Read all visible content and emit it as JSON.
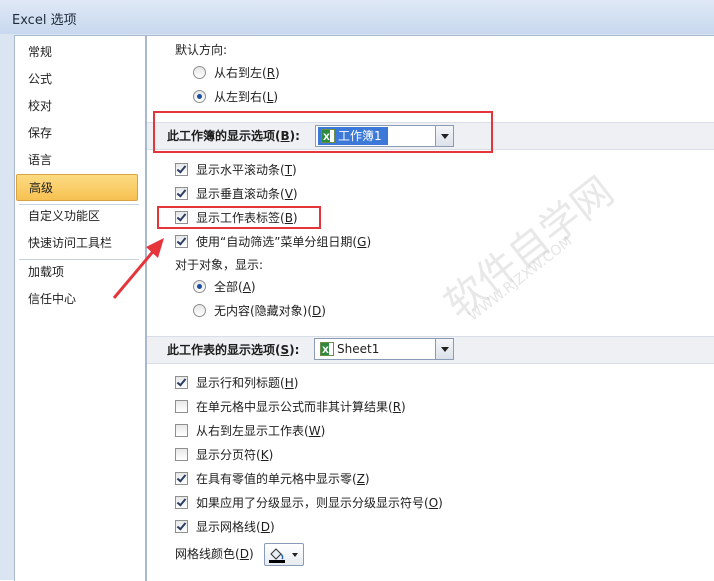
{
  "window": {
    "title": "Excel 选项"
  },
  "sidebar": {
    "items": [
      {
        "label": "常规"
      },
      {
        "label": "公式"
      },
      {
        "label": "校对"
      },
      {
        "label": "保存"
      },
      {
        "label": "语言"
      },
      {
        "label": "高级",
        "active": true
      },
      {
        "label": "自定义功能区"
      },
      {
        "label": "快速访问工具栏"
      },
      {
        "label": "加载项"
      },
      {
        "label": "信任中心"
      }
    ]
  },
  "direction": {
    "label": "默认方向:",
    "rtl": {
      "text": "从右到左(",
      "key": "R",
      "end": ")",
      "checked": false
    },
    "ltr": {
      "text": "从左到右(",
      "key": "L",
      "end": ")",
      "checked": true
    }
  },
  "workbook_section": {
    "label_pre": "此工作簿的显示选项(",
    "key": "B",
    "label_post": "):",
    "selected": "工作簿1"
  },
  "workbook_options": [
    {
      "text": "显示水平滚动条(",
      "key": "T",
      "end": ")",
      "checked": true
    },
    {
      "text": "显示垂直滚动条(",
      "key": "V",
      "end": ")",
      "checked": true
    },
    {
      "text": "显示工作表标签(",
      "key": "B",
      "end": ")",
      "checked": true
    },
    {
      "text": "使用“自动筛选”菜单分组日期(",
      "key": "G",
      "end": ")",
      "checked": true
    }
  ],
  "objects": {
    "label": "对于对象，显示:",
    "all": {
      "text": "全部(",
      "key": "A",
      "end": ")",
      "checked": true
    },
    "none": {
      "text": "无内容(隐藏对象)(",
      "key": "D",
      "end": ")",
      "checked": false
    }
  },
  "sheet_section": {
    "label_pre": "此工作表的显示选项(",
    "key": "S",
    "label_post": "):",
    "selected": "Sheet1"
  },
  "sheet_options": [
    {
      "text": "显示行和列标题(",
      "key": "H",
      "end": ")",
      "checked": true
    },
    {
      "text": "在单元格中显示公式而非其计算结果(",
      "key": "R",
      "end": ")",
      "checked": false
    },
    {
      "text": "从右到左显示工作表(",
      "key": "W",
      "end": ")",
      "checked": false
    },
    {
      "text": "显示分页符(",
      "key": "K",
      "end": ")",
      "checked": false
    },
    {
      "text": "在具有零值的单元格中显示零(",
      "key": "Z",
      "end": ")",
      "checked": true
    },
    {
      "text": "如果应用了分级显示，则显示分级显示符号(",
      "key": "O",
      "end": ")",
      "checked": true
    },
    {
      "text": "显示网格线(",
      "key": "D",
      "end": ")",
      "checked": true
    }
  ],
  "gridline_color": {
    "text": "网格线颜色(",
    "key": "D",
    "end": ")"
  },
  "watermark": {
    "main": "软件自学网",
    "sub": "WWW.RJZXW.COM"
  },
  "colors": {
    "highlight_red": "#e5353b",
    "active_nav": "#f7c152",
    "combo_selected": "#3c78d8"
  }
}
